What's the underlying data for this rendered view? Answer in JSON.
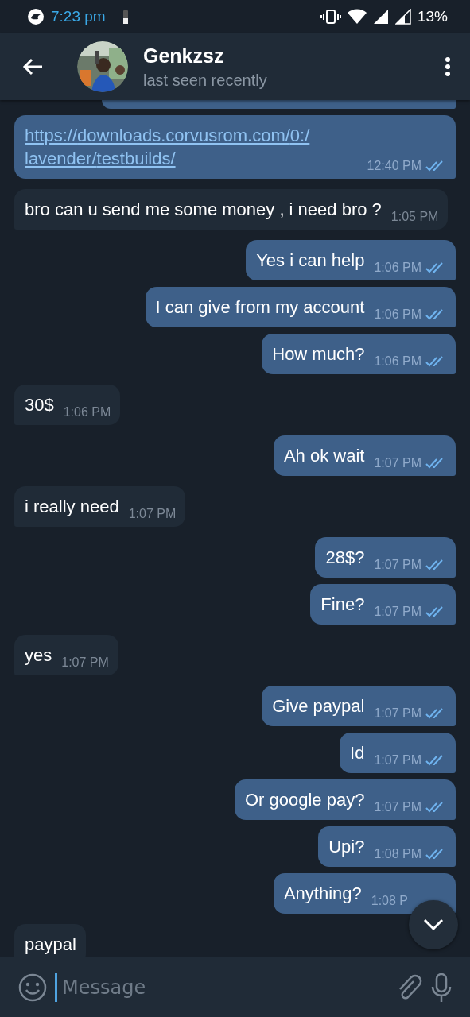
{
  "status_bar": {
    "time": "7:23 pm",
    "battery": "13%"
  },
  "header": {
    "name": "Genkzsz",
    "status": "last seen recently"
  },
  "messages": [
    {
      "kind": "partial",
      "outgoing": true
    },
    {
      "kind": "link",
      "outgoing": true,
      "text": "https://downloads.corvusrom.com/0:/lavender/testbuilds/",
      "time": "12:40 PM",
      "read": true
    },
    {
      "kind": "text",
      "outgoing": false,
      "text": "bro can u send me some money , i need bro ?",
      "time": "1:05 PM"
    },
    {
      "kind": "text",
      "outgoing": true,
      "text": "Yes i can help",
      "time": "1:06 PM",
      "read": true
    },
    {
      "kind": "text",
      "outgoing": true,
      "text": "I can give from my account",
      "time": "1:06 PM",
      "read": true
    },
    {
      "kind": "text",
      "outgoing": true,
      "text": "How much?",
      "time": "1:06 PM",
      "read": true
    },
    {
      "kind": "text",
      "outgoing": false,
      "text": "30$",
      "time": "1:06 PM"
    },
    {
      "kind": "text",
      "outgoing": true,
      "text": "Ah ok wait",
      "time": "1:07 PM",
      "read": true
    },
    {
      "kind": "text",
      "outgoing": false,
      "text": "i really need",
      "time": "1:07 PM"
    },
    {
      "kind": "text",
      "outgoing": true,
      "text": "28$?",
      "time": "1:07 PM",
      "read": true
    },
    {
      "kind": "text",
      "outgoing": true,
      "text": "Fine?",
      "time": "1:07 PM",
      "read": true
    },
    {
      "kind": "text",
      "outgoing": false,
      "text": "yes",
      "time": "1:07 PM"
    },
    {
      "kind": "text",
      "outgoing": true,
      "text": "Give paypal",
      "time": "1:07 PM",
      "read": true
    },
    {
      "kind": "text",
      "outgoing": true,
      "text": "Id",
      "time": "1:07 PM",
      "read": true
    },
    {
      "kind": "text",
      "outgoing": true,
      "text": "Or google pay?",
      "time": "1:07 PM",
      "read": true
    },
    {
      "kind": "text",
      "outgoing": true,
      "text": "Upi?",
      "time": "1:08 PM",
      "read": true
    },
    {
      "kind": "text",
      "outgoing": true,
      "text": "Anything?",
      "time": "1:08 P"
    },
    {
      "kind": "text",
      "outgoing": false,
      "text": "paypal"
    }
  ],
  "composer": {
    "placeholder": "Message"
  }
}
